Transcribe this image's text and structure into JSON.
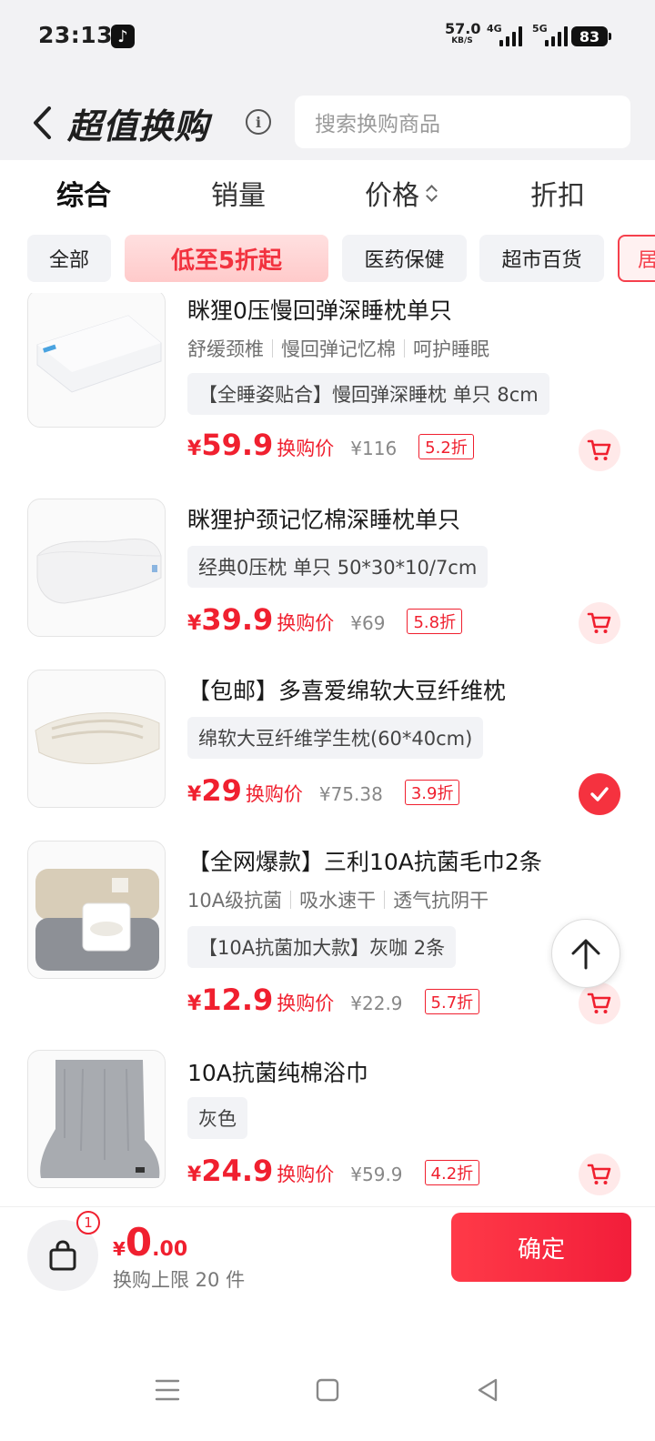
{
  "status_bar": {
    "time": "23:13",
    "net_speed_value": "57.0",
    "net_speed_unit": "KB/S",
    "signal_1": "4G",
    "signal_2": "5G",
    "battery": "83"
  },
  "header": {
    "title": "超值换购",
    "search_placeholder": "搜索换购商品"
  },
  "sort_tabs": [
    "综合",
    "销量",
    "价格",
    "折扣"
  ],
  "chips": [
    "全部",
    "低至5折起",
    "医药保健",
    "超市百货",
    "居"
  ],
  "products": [
    {
      "title": "眯狸0压慢回弹深睡枕单只",
      "tags": [
        "舒缓颈椎",
        "慢回弹记忆棉",
        "呵护睡眠"
      ],
      "spec": "【全睡姿贴合】慢回弹深睡枕 单只 8cm",
      "price": "59.9",
      "price_label": "换购价",
      "original": "¥116",
      "discount": "5.2折",
      "selected": false
    },
    {
      "title": "眯狸护颈记忆棉深睡枕单只",
      "tags": [],
      "spec": "经典0压枕 单只 50*30*10/7cm",
      "price": "39.9",
      "price_label": "换购价",
      "original": "¥69",
      "discount": "5.8折",
      "selected": false
    },
    {
      "title": "【包邮】多喜爱绵软大豆纤维枕",
      "tags": [],
      "spec": "绵软大豆纤维学生枕(60*40cm)",
      "price": "29",
      "price_label": "换购价",
      "original": "¥75.38",
      "discount": "3.9折",
      "selected": true
    },
    {
      "title": "【全网爆款】三利10A抗菌毛巾2条",
      "tags": [
        "10A级抗菌",
        "吸水速干",
        "透气抗阴干"
      ],
      "spec": "【10A抗菌加大款】灰咖 2条",
      "price": "12.9",
      "price_label": "换购价",
      "original": "¥22.9",
      "discount": "5.7折",
      "selected": false
    },
    {
      "title": "10A抗菌纯棉浴巾",
      "tags": [],
      "spec": "灰色",
      "price": "24.9",
      "price_label": "换购价",
      "original": "¥59.9",
      "discount": "4.2折",
      "selected": false
    }
  ],
  "bottom_bar": {
    "badge_count": "1",
    "currency": "¥",
    "total_int": "0",
    "total_dec": ".00",
    "limit_text": "换购上限 20 件",
    "confirm_label": "确定"
  },
  "colors": {
    "accent_red": "#f0202f",
    "chip_bg": "#f2f3f6",
    "header_bg": "#f2f2f4"
  },
  "icons": [
    "back-arrow-icon",
    "info-icon",
    "sort-arrows-icon",
    "cart-icon",
    "check-icon",
    "arrow-up-icon",
    "shopping-bag-icon",
    "menu-icon",
    "home-square-icon",
    "back-triangle-icon"
  ]
}
